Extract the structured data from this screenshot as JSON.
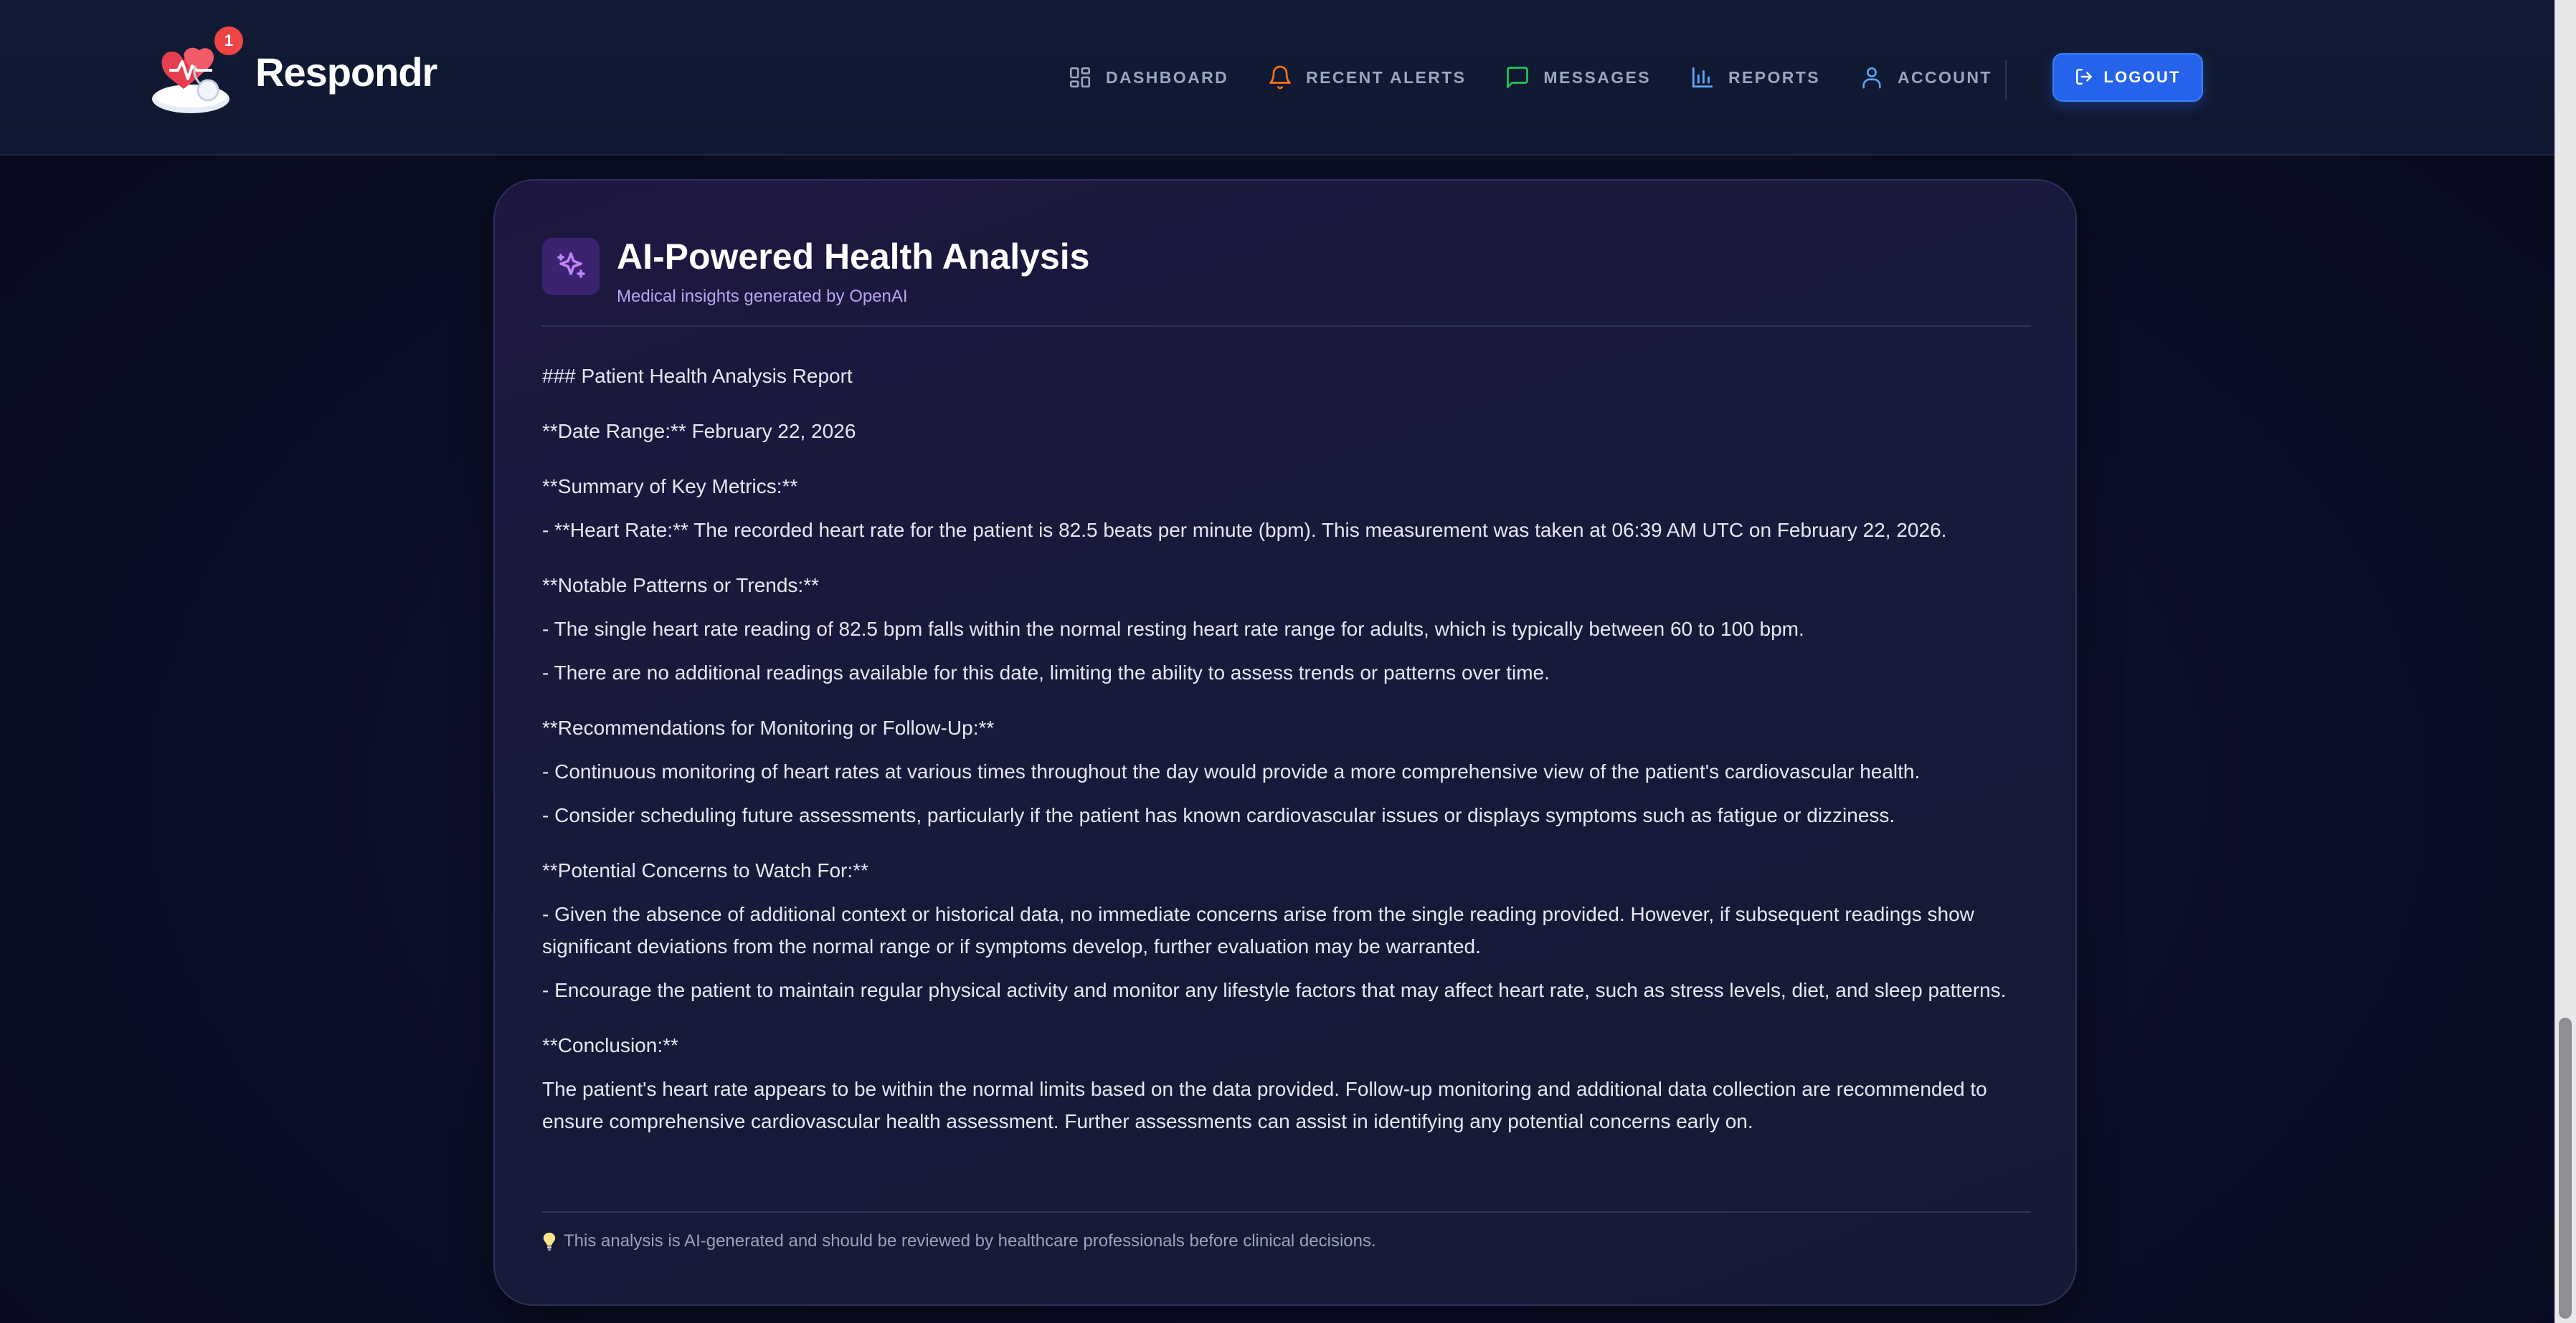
{
  "brand": {
    "name": "Respondr",
    "notification_count": "1"
  },
  "nav": {
    "items": [
      {
        "label": "DASHBOARD",
        "icon": "dashboard-grid-icon"
      },
      {
        "label": "RECENT ALERTS",
        "icon": "bell-icon"
      },
      {
        "label": "MESSAGES",
        "icon": "chat-bubble-icon"
      },
      {
        "label": "REPORTS",
        "icon": "bar-chart-icon"
      },
      {
        "label": "ACCOUNT",
        "icon": "user-icon"
      }
    ],
    "logout_label": "LOGOUT"
  },
  "analysis": {
    "title": "AI-Powered Health Analysis",
    "subtitle": "Medical insights generated by OpenAI",
    "paragraphs": [
      "### Patient Health Analysis Report",
      "**Date Range:** February 22, 2026",
      "**Summary of Key Metrics:**",
      "- **Heart Rate:** The recorded heart rate for the patient is 82.5 beats per minute (bpm). This measurement was taken at 06:39 AM UTC on February 22, 2026.",
      "**Notable Patterns or Trends:**",
      "- The single heart rate reading of 82.5 bpm falls within the normal resting heart rate range for adults, which is typically between 60 to 100 bpm.",
      "- There are no additional readings available for this date, limiting the ability to assess trends or patterns over time.",
      "**Recommendations for Monitoring or Follow-Up:**",
      "- Continuous monitoring of heart rates at various times throughout the day would provide a more comprehensive view of the patient's cardiovascular health.",
      "- Consider scheduling future assessments, particularly if the patient has known cardiovascular issues or displays symptoms such as fatigue or dizziness.",
      "**Potential Concerns to Watch For:**",
      "- Given the absence of additional context or historical data, no immediate concerns arise from the single reading provided. However, if subsequent readings show significant deviations from the normal range or if symptoms develop, further evaluation may be warranted.",
      "- Encourage the patient to maintain regular physical activity and monitor any lifestyle factors that may affect heart rate, such as stress levels, diet, and sleep patterns.",
      "**Conclusion:**",
      "The patient's heart rate appears to be within the normal limits based on the data provided. Follow-up monitoring and additional data collection are recommended to ensure comprehensive cardiovascular health assessment. Further assessments can assist in identifying any potential concerns early on."
    ],
    "disclaimer": "This analysis is AI-generated and should be reviewed by healthcare professionals before clinical decisions."
  },
  "colors": {
    "accent": "#2563eb",
    "alert": "#ef4444",
    "purple": "#a855f7"
  }
}
